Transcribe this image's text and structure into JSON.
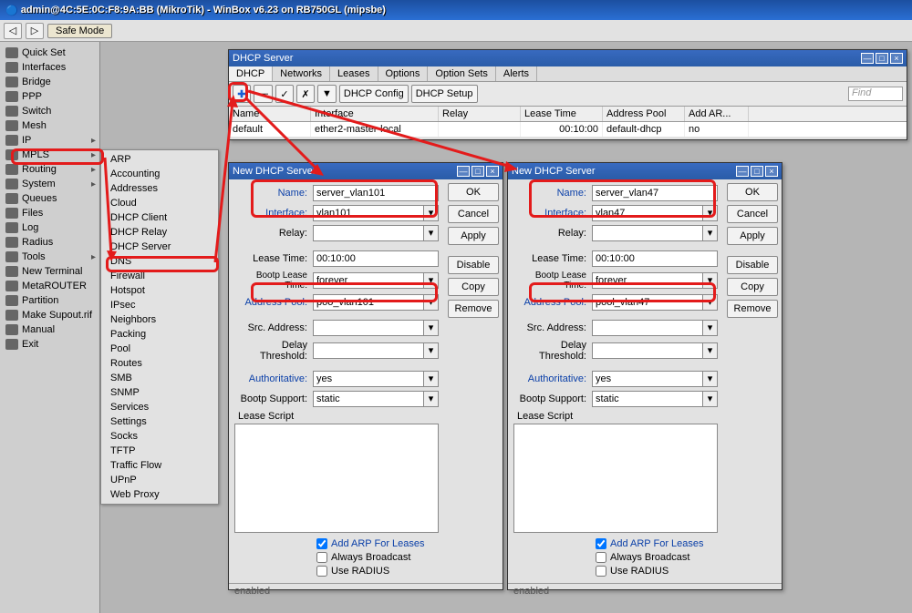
{
  "title_bar": "admin@4C:5E:0C:F8:9A:BB (MikroTik) - WinBox v6.23 on RB750GL (mipsbe)",
  "toolbar": {
    "safe_mode": "Safe Mode"
  },
  "sidebar": {
    "items": [
      {
        "label": "Quick Set"
      },
      {
        "label": "Interfaces"
      },
      {
        "label": "Bridge"
      },
      {
        "label": "PPP"
      },
      {
        "label": "Switch"
      },
      {
        "label": "Mesh"
      },
      {
        "label": "IP",
        "arrow": true
      },
      {
        "label": "MPLS",
        "arrow": true
      },
      {
        "label": "Routing",
        "arrow": true
      },
      {
        "label": "System",
        "arrow": true
      },
      {
        "label": "Queues"
      },
      {
        "label": "Files"
      },
      {
        "label": "Log"
      },
      {
        "label": "Radius"
      },
      {
        "label": "Tools",
        "arrow": true
      },
      {
        "label": "New Terminal"
      },
      {
        "label": "MetaROUTER"
      },
      {
        "label": "Partition"
      },
      {
        "label": "Make Supout.rif"
      },
      {
        "label": "Manual"
      },
      {
        "label": "Exit"
      }
    ]
  },
  "ip_menu": {
    "items": [
      "ARP",
      "Accounting",
      "Addresses",
      "Cloud",
      "DHCP Client",
      "DHCP Relay",
      "DHCP Server",
      "DNS",
      "Firewall",
      "Hotspot",
      "IPsec",
      "Neighbors",
      "Packing",
      "Pool",
      "Routes",
      "SMB",
      "SNMP",
      "Services",
      "Settings",
      "Socks",
      "TFTP",
      "Traffic Flow",
      "UPnP",
      "Web Proxy"
    ]
  },
  "dhcp_server_win": {
    "title": "DHCP Server",
    "tabs": [
      "DHCP",
      "Networks",
      "Leases",
      "Options",
      "Option Sets",
      "Alerts"
    ],
    "buttons": {
      "config": "DHCP Config",
      "setup": "DHCP Setup",
      "find": "Find"
    },
    "columns": [
      "Name",
      "Interface",
      "Relay",
      "Lease Time",
      "Address Pool",
      "Add AR..."
    ],
    "row": {
      "name": "default",
      "interface": "ether2-master-local",
      "relay": "",
      "lease": "00:10:00",
      "pool": "default-dhcp",
      "addarp": "no"
    }
  },
  "dialog1": {
    "title": "New DHCP Server",
    "name": "server_vlan101",
    "interface": "vlan101",
    "relay": "",
    "lease_time": "00:10:00",
    "lease_time_label": "Lease Time:",
    "bootp_lease_time": "forever",
    "address_pool": "poo_vlan101",
    "src_address": "",
    "delay_threshold": "",
    "authoritative": "yes",
    "bootp_support": "static",
    "lease_script_label": "Lease Script",
    "add_arp": "Add ARP For Leases",
    "always_broadcast": "Always Broadcast",
    "use_radius": "Use RADIUS",
    "status": "enabled",
    "btns": {
      "ok": "OK",
      "cancel": "Cancel",
      "apply": "Apply",
      "disable": "Disable",
      "copy": "Copy",
      "remove": "Remove"
    }
  },
  "dialog2": {
    "title": "New DHCP Server",
    "name": "server_vlan47",
    "interface": "vlan47",
    "relay": "",
    "lease_time": "00:10:00",
    "lease_time_label": "Lease Time:",
    "bootp_lease_time": "forever",
    "address_pool": "pool_vlan47",
    "src_address": "",
    "delay_threshold": "",
    "authoritative": "yes",
    "bootp_support": "static",
    "lease_script_label": "Lease Script",
    "add_arp": "Add ARP For Leases",
    "always_broadcast": "Always Broadcast",
    "use_radius": "Use RADIUS",
    "status": "enabled",
    "btns": {
      "ok": "OK",
      "cancel": "Cancel",
      "apply": "Apply",
      "disable": "Disable",
      "copy": "Copy",
      "remove": "Remove"
    }
  },
  "labels": {
    "name": "Name:",
    "interface": "Interface:",
    "relay": "Relay:",
    "bootp_lease": "Bootp Lease Time:",
    "address_pool": "Address Pool:",
    "src_address": "Src. Address:",
    "delay": "Delay Threshold:",
    "auth": "Authoritative:",
    "bootp_support": "Bootp Support:"
  }
}
